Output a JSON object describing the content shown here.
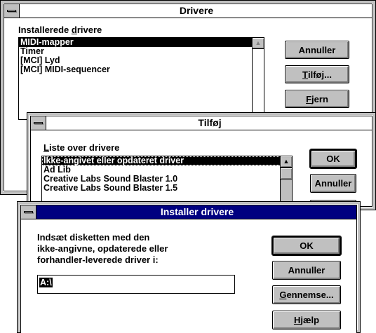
{
  "drivers_window": {
    "title": "Drivere",
    "installed_label_pre": "Installerede ",
    "installed_label_u": "d",
    "installed_label_post": "rivere",
    "items": [
      "MIDI-mapper",
      "Timer",
      "[MCI] Lyd",
      "[MCI] MIDI-sequencer"
    ],
    "cancel_label": "Annuller",
    "add_label_u": "T",
    "add_label_rest": "ilføj...",
    "remove_label_u": "F",
    "remove_label_rest": "jern"
  },
  "add_window": {
    "title": "Tilføj",
    "list_label_u": "L",
    "list_label_rest": "iste over drivere",
    "items": [
      "Ikke-angivet eller opdateret driver",
      "Ad Lib",
      "Creative Labs Sound Blaster 1.0",
      "Creative Labs Sound Blaster 1.5"
    ],
    "ok_label": "OK",
    "cancel_label": "Annuller"
  },
  "install_window": {
    "title": "Installer drivere",
    "prompt_line1": "Indsæt disketten med den",
    "prompt_line2": "ikke-angivne, opdaterede eller",
    "prompt_line3": "forhandler-leverede driver i:",
    "path_value": "A:\\",
    "ok_label": "OK",
    "cancel_label": "Annuller",
    "browse_label_u": "G",
    "browse_label_rest": "ennemse...",
    "help_label_u": "H",
    "help_label_rest": "jælp"
  },
  "icons": {
    "system_menu": "system-menu-icon",
    "scroll_up": "scroll-up-arrow-icon"
  },
  "colors": {
    "active_title": "#000080",
    "face": "#c0c0c0"
  }
}
